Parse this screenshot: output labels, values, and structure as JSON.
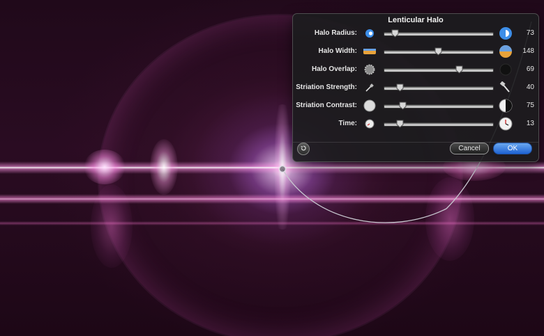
{
  "hud": {
    "title": "Lenticular Halo",
    "params": [
      {
        "label": "Halo Radius:",
        "value": "73",
        "level": 0.1,
        "min_icon": "small-radius-icon",
        "max_icon": "large-radius-icon"
      },
      {
        "label": "Halo Width:",
        "value": "148",
        "level": 0.5,
        "min_icon": "thin-width-icon",
        "max_icon": "wide-width-icon"
      },
      {
        "label": "Halo Overlap:",
        "value": "69",
        "level": 0.69,
        "min_icon": "gear-overlap-icon",
        "max_icon": "dark-circle-icon"
      },
      {
        "label": "Striation Strength:",
        "value": "40",
        "level": 0.15,
        "min_icon": "small-hammer-icon",
        "max_icon": "large-hammer-icon"
      },
      {
        "label": "Striation Contrast:",
        "value": "75",
        "level": 0.17,
        "min_icon": "low-contrast-icon",
        "max_icon": "high-contrast-icon"
      },
      {
        "label": "Time:",
        "value": "13",
        "level": 0.15,
        "min_icon": "small-clock-icon",
        "max_icon": "large-clock-icon"
      }
    ],
    "reset_icon": "reset-arrow-icon",
    "cancel_label": "Cancel",
    "ok_label": "OK"
  },
  "colors": {
    "accent": "#2f75e0",
    "hud_bg": "#1c1c1e",
    "flare": "#ff8ce0"
  }
}
